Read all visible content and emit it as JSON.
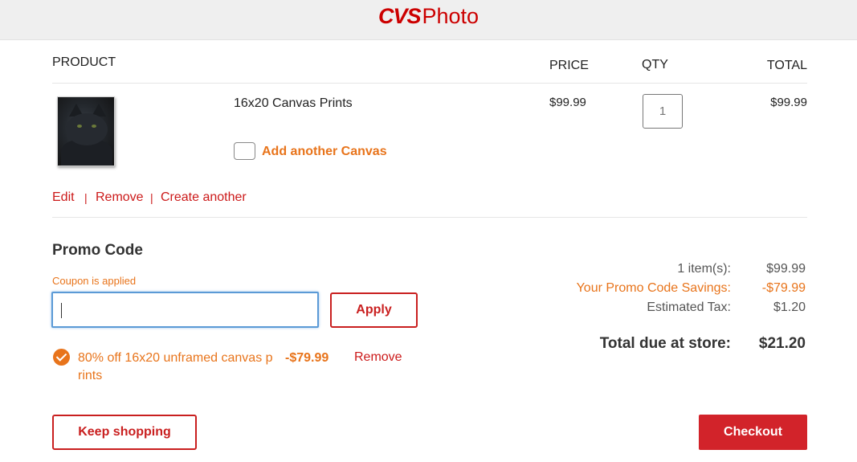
{
  "header": {
    "logo_brand": "CVS",
    "logo_product": "Photo"
  },
  "table": {
    "col_product": "PRODUCT",
    "col_price": "PRICE",
    "col_qty": "QTY",
    "col_total": "TOTAL"
  },
  "item": {
    "name": "16x20 Canvas Prints",
    "price": "$99.99",
    "qty": "1",
    "total": "$99.99",
    "add_another_label": "Add another Canvas",
    "actions": {
      "edit": "Edit",
      "sep1": "|",
      "remove": "Remove",
      "sep2": "|",
      "create_another": "Create another"
    }
  },
  "promo": {
    "title": "Promo Code",
    "status": "Coupon is applied",
    "input_value": "",
    "apply_label": "Apply",
    "applied_line1": "80% off 16x20 unframed canvas p",
    "applied_line2": "rints",
    "applied_amount": "-$79.99",
    "applied_remove": "Remove"
  },
  "summary": {
    "items_label": "1 item(s):",
    "items_value": "$99.99",
    "savings_label": "Your Promo Code Savings:",
    "savings_value": "-$79.99",
    "tax_label": "Estimated Tax:",
    "tax_value": "$1.20",
    "total_label": "Total due at store:",
    "total_value": "$21.20"
  },
  "buttons": {
    "keep_shopping": "Keep shopping",
    "checkout": "Checkout"
  },
  "colors": {
    "brand_red": "#cc0000",
    "accent_orange": "#e8741b",
    "focus_blue": "#5b9ad6"
  },
  "icons": {
    "applied": "check-circle-icon"
  }
}
